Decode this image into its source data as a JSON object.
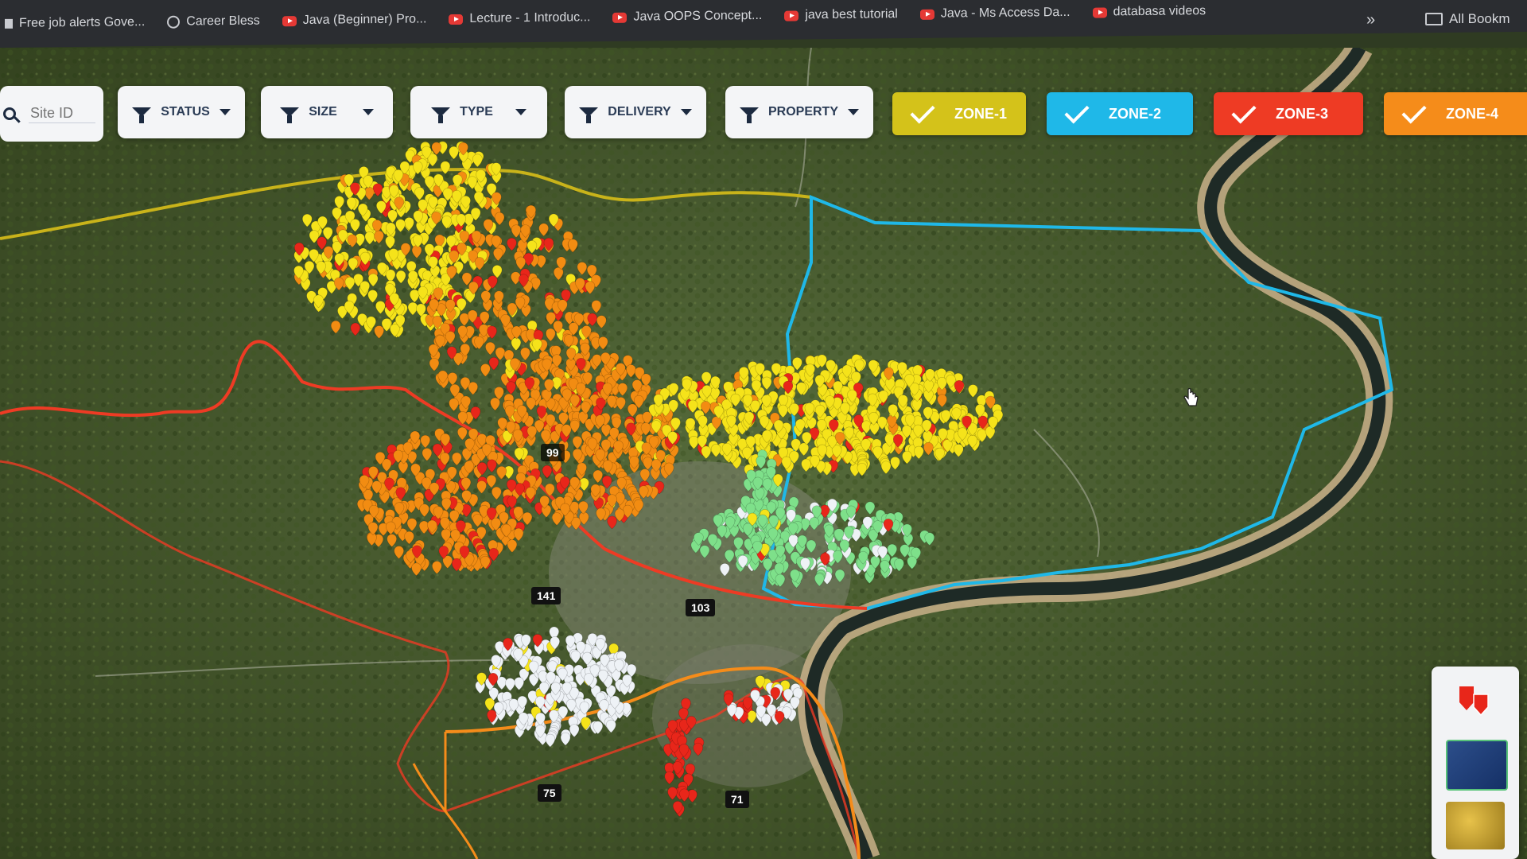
{
  "bookmarks": [
    {
      "label": "Free job alerts Gove...",
      "icon": "page-icon"
    },
    {
      "label": "Career Bless",
      "icon": "globe-icon"
    },
    {
      "label": "Java (Beginner) Pro...",
      "icon": "youtube-icon"
    },
    {
      "label": "Lecture - 1 Introduc...",
      "icon": "youtube-icon"
    },
    {
      "label": "Java OOPS Concept...",
      "icon": "youtube-icon"
    },
    {
      "label": "java best tutorial",
      "icon": "youtube-icon"
    },
    {
      "label": "Java - Ms Access Da...",
      "icon": "youtube-icon"
    },
    {
      "label": "databasa videos",
      "icon": "youtube-icon"
    }
  ],
  "bookmarks_more": "»",
  "bookmarks_all": "All Bookm",
  "search": {
    "placeholder": "Site ID"
  },
  "filters": [
    {
      "label": "STATUS"
    },
    {
      "label": "SIZE"
    },
    {
      "label": "TYPE"
    },
    {
      "label": "DELIVERY"
    },
    {
      "label": "PROPERTY"
    }
  ],
  "zones": [
    {
      "label": "ZONE-1",
      "color": "#d4c21a",
      "checked": true
    },
    {
      "label": "ZONE-2",
      "color": "#1fb8e8",
      "checked": true
    },
    {
      "label": "ZONE-3",
      "color": "#ee3b24",
      "checked": true
    },
    {
      "label": "ZONE-4",
      "color": "#f58c1a",
      "checked": true
    }
  ],
  "cluster_labels": [
    "141",
    "103",
    "75",
    "71",
    "99"
  ],
  "legend_colors": {
    "yellow": "#f5e31a",
    "orange": "#f28c12",
    "red": "#e8261a",
    "green": "#7ee08a",
    "white": "#eef2f6"
  },
  "layer_switcher": [
    "sites-layer",
    "map-layer",
    "satellite-layer"
  ]
}
